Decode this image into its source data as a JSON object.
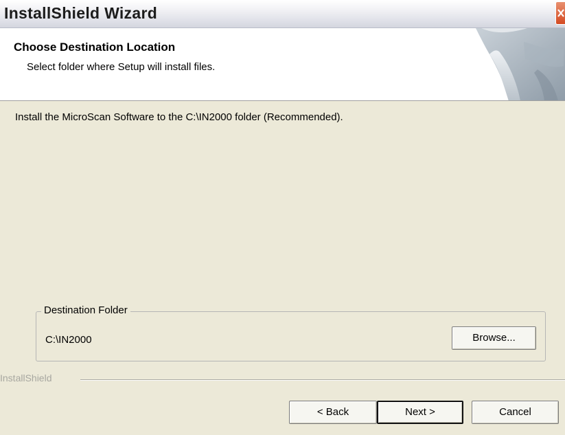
{
  "window": {
    "title": "InstallShield Wizard",
    "close_icon": "close-icon"
  },
  "header": {
    "title": "Choose Destination Location",
    "subtitle": "Select folder where Setup will install files."
  },
  "body": {
    "install_message": "Install the MicroScan Software to the C:\\IN2000 folder (Recommended).",
    "destination_folder": {
      "label": "Destination Folder",
      "path": "C:\\IN2000",
      "browse_label": "Browse..."
    }
  },
  "footer": {
    "brand": "InstallShield",
    "back_label": "< Back",
    "next_label": "Next >",
    "cancel_label": "Cancel"
  },
  "colors": {
    "dialog_bg": "#ECE9D8",
    "header_bg": "#FFFFFF",
    "close_button": "#D44A22"
  }
}
